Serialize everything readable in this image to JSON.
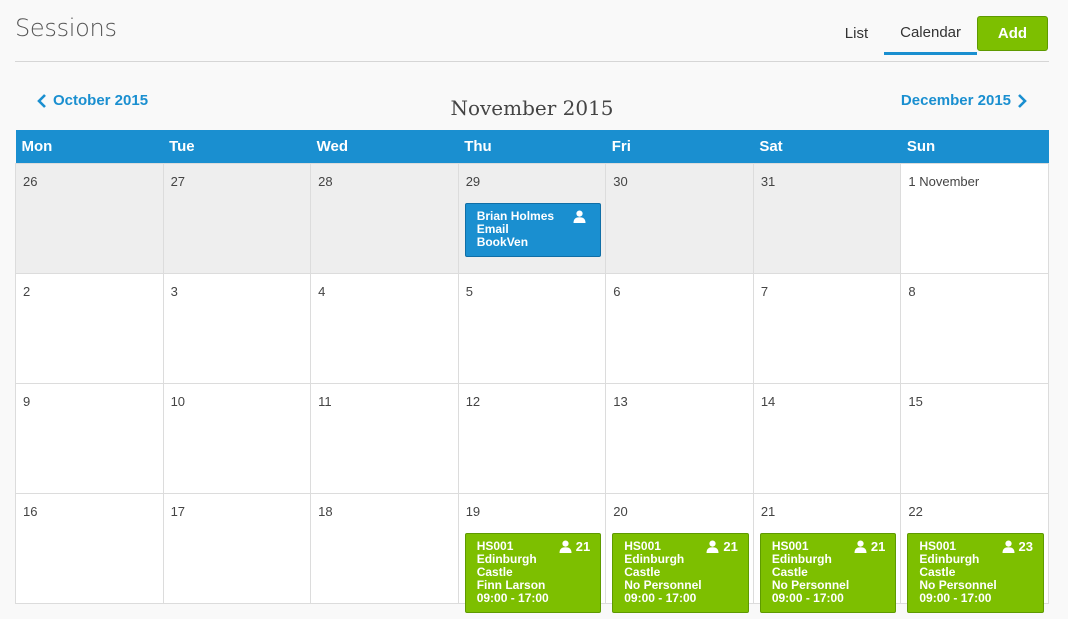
{
  "header": {
    "title": "Sessions",
    "tabs": [
      {
        "label": "List",
        "active": false
      },
      {
        "label": "Calendar",
        "active": true
      }
    ],
    "add_label": "Add"
  },
  "nav": {
    "prev_label": "October 2015",
    "next_label": "December 2015",
    "current_month": "November 2015"
  },
  "weekdays": [
    "Mon",
    "Tue",
    "Wed",
    "Thu",
    "Fri",
    "Sat",
    "Sun"
  ],
  "weeks": [
    [
      {
        "day": "26",
        "other": true
      },
      {
        "day": "27",
        "other": true
      },
      {
        "day": "28",
        "other": true
      },
      {
        "day": "29",
        "other": true,
        "event": {
          "color": "blue",
          "lines": [
            "Brian Holmes",
            "Email",
            "BookVen"
          ],
          "icon": "person-icon",
          "count": ""
        }
      },
      {
        "day": "30",
        "other": true
      },
      {
        "day": "31",
        "other": true
      },
      {
        "day": "1 November",
        "other": false
      }
    ],
    [
      {
        "day": "2"
      },
      {
        "day": "3"
      },
      {
        "day": "4"
      },
      {
        "day": "5"
      },
      {
        "day": "6"
      },
      {
        "day": "7"
      },
      {
        "day": "8"
      }
    ],
    [
      {
        "day": "9"
      },
      {
        "day": "10"
      },
      {
        "day": "11"
      },
      {
        "day": "12"
      },
      {
        "day": "13"
      },
      {
        "day": "14"
      },
      {
        "day": "15"
      }
    ],
    [
      {
        "day": "16"
      },
      {
        "day": "17"
      },
      {
        "day": "18"
      },
      {
        "day": "19",
        "event": {
          "color": "green",
          "lines": [
            "HS001",
            "Edinburgh",
            "Castle",
            "Finn Larson",
            "09:00 - 17:00"
          ],
          "icon": "person-icon",
          "count": "21"
        }
      },
      {
        "day": "20",
        "event": {
          "color": "green",
          "lines": [
            "HS001",
            "Edinburgh",
            "Castle",
            "No Personnel",
            "09:00 - 17:00"
          ],
          "icon": "person-icon",
          "count": "21"
        }
      },
      {
        "day": "21",
        "event": {
          "color": "green",
          "lines": [
            "HS001",
            "Edinburgh",
            "Castle",
            "No Personnel",
            "09:00 - 17:00"
          ],
          "icon": "person-icon",
          "count": "21"
        }
      },
      {
        "day": "22",
        "event": {
          "color": "green",
          "lines": [
            "HS001",
            "Edinburgh",
            "Castle",
            "No Personnel",
            "09:00 - 17:00"
          ],
          "icon": "person-icon",
          "count": "23"
        }
      }
    ]
  ],
  "colors": {
    "accent": "#1a8fd0",
    "add_button": "#7dbf00",
    "event_blue": "#1a8fd0",
    "event_green": "#7dbf00",
    "other_month_bg": "#eeeeee"
  }
}
